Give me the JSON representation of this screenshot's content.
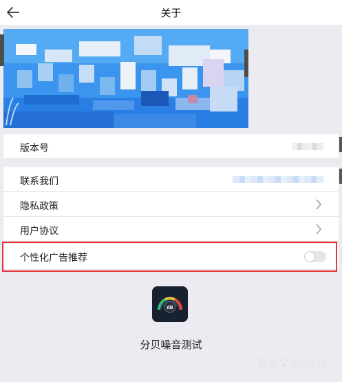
{
  "header": {
    "title": "关于",
    "back_icon": "arrow-left-icon"
  },
  "rows": {
    "version": {
      "label": "版本号"
    },
    "contact": {
      "label": "联系我们"
    },
    "privacy": {
      "label": "隐私政策",
      "icon": "chevron-right-icon"
    },
    "agreement": {
      "label": "用户协议",
      "icon": "chevron-right-icon"
    },
    "ads": {
      "label": "个性化广告推荐",
      "toggle_on": false
    }
  },
  "app": {
    "name": "分贝噪音测试",
    "icon_text": "dB"
  },
  "watermark": {
    "brand": "Bai",
    "brand_end": "du",
    "suffix": "经验"
  },
  "colors": {
    "highlight": "#e8323a",
    "background": "#ecebf1",
    "banner": "#2e8ef0"
  }
}
